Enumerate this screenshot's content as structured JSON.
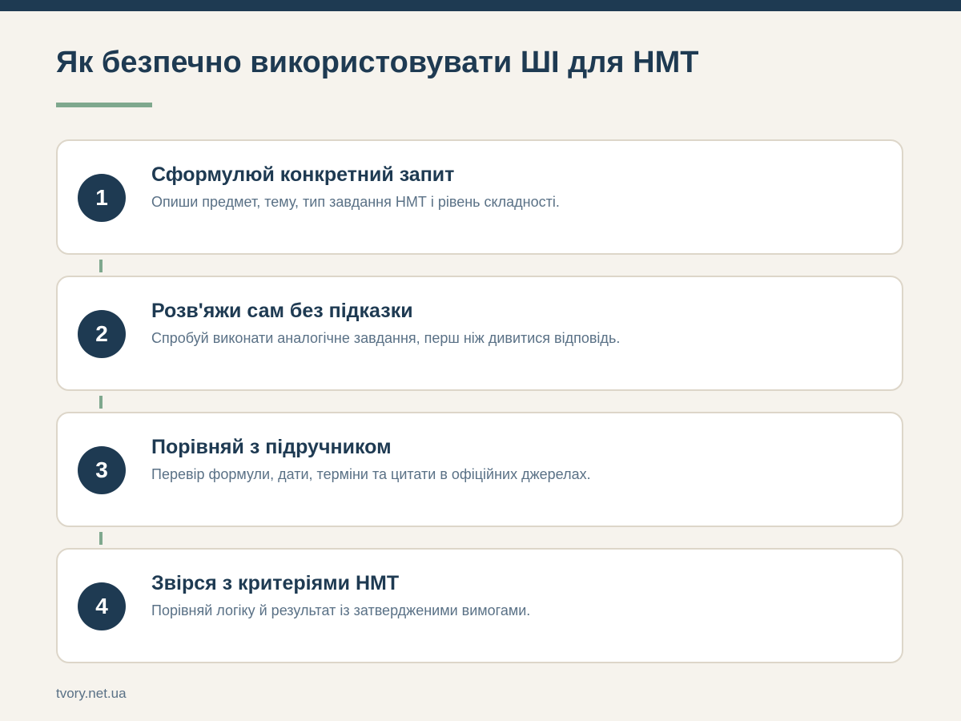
{
  "header": {
    "title": "Як безпечно використовувати ШІ для НМТ"
  },
  "steps": [
    {
      "number": "1",
      "title": "Сформулюй конкретний запит",
      "description": "Опиши предмет, тему, тип завдання НМТ і рівень складності."
    },
    {
      "number": "2",
      "title": "Розв'яжи сам без підказки",
      "description": "Спробуй виконати аналогічне завдання, перш ніж дивитися відповідь."
    },
    {
      "number": "3",
      "title": "Порівняй з підручником",
      "description": "Перевір формули, дати, терміни та цитати в офіційних джерелах."
    },
    {
      "number": "4",
      "title": "Звірся з критеріями НМТ",
      "description": "Порівняй логіку й результат із затвердженими вимогами."
    }
  ],
  "footer": {
    "source": "tvory.net.ua"
  },
  "colors": {
    "background": "#f6f3ed",
    "primary": "#1e3a52",
    "accent": "#7fa88e",
    "muted_text": "#5a7186",
    "card_border": "#ddd6c9"
  }
}
